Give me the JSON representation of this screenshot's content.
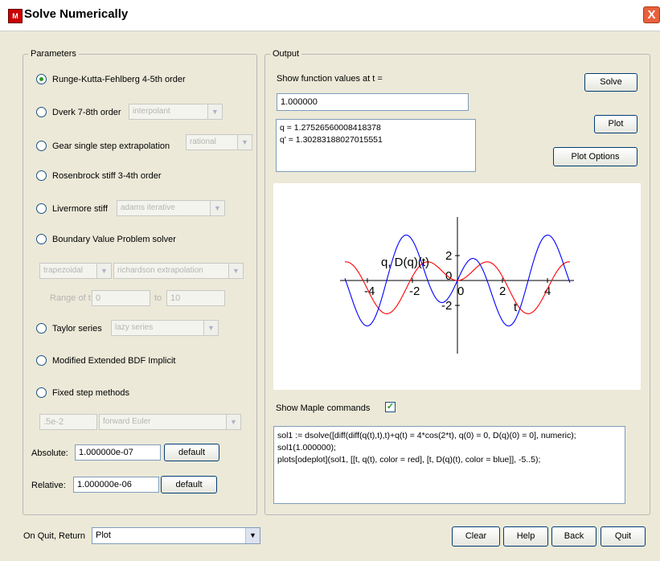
{
  "window": {
    "title": "Solve Numerically",
    "close_label": "X"
  },
  "parameters": {
    "legend": "Parameters",
    "methods": [
      {
        "label": "Runge-Kutta-Fehlberg 4-5th order",
        "selected": true
      },
      {
        "label": "Dverk 7-8th order",
        "option": "interpolant"
      },
      {
        "label": "Gear single step extrapolation",
        "option": "rational"
      },
      {
        "label": "Rosenbrock stiff 3-4th order"
      },
      {
        "label": "Livermore stiff",
        "option": "adams iterative"
      },
      {
        "label": "Boundary Value Problem solver"
      },
      {
        "label": "Taylor series",
        "option": "lazy series"
      },
      {
        "label": "Modified Extended BDF Implicit"
      },
      {
        "label": "Fixed step methods"
      }
    ],
    "bvp": {
      "method": "trapezoidal",
      "extrapolation": "richardson extrapolation",
      "range_label": "Range of t:",
      "range_from": "0",
      "to_label": "to",
      "range_to": "10"
    },
    "fixed_step": {
      "step": ".5e-2",
      "method": "forward Euler"
    },
    "absolute": {
      "label": "Absolute:",
      "value": "1.000000e-07",
      "default_label": "default"
    },
    "relative": {
      "label": "Relative:",
      "value": "1.000000e-06",
      "default_label": "default"
    }
  },
  "output": {
    "legend": "Output",
    "show_label": "Show function values at t =",
    "t_value": "1.000000",
    "results": "q = 1.27526560008418378\nq' = 1.30283188027015551",
    "solve_label": "Solve",
    "plot_label": "Plot",
    "plot_options_label": "Plot Options",
    "show_maple_label": "Show Maple commands",
    "show_maple_checked": true,
    "commands": "sol1 := dsolve([diff(diff(q(t),t),t)+q(t) = 4*cos(2*t), q(0) = 0, D(q)(0) = 0], numeric);\nsol1(1.000000);\nplots[odeplot](sol1, [[t, q(t), color = red], [t, D(q)(t), color = blue]], -5..5);"
  },
  "chart_data": {
    "type": "line",
    "xlabel": "t",
    "ylabel": "q, D(q)(t)",
    "xlim": [
      -5,
      5
    ],
    "ylim": [
      -3,
      3
    ],
    "xticks": [
      "-4",
      "-2",
      "0",
      "2",
      "4"
    ],
    "yticks": [
      "2",
      "0",
      "-2"
    ],
    "series": [
      {
        "color": "#ff0000",
        "formula": "q(t) = (4/3)(cos(t) - cos(2t))"
      },
      {
        "color": "#0000ff",
        "formula": "D(q)(t) = (4/3)(2 sin(2t) - sin(t))"
      }
    ]
  },
  "footer": {
    "on_quit_label": "On Quit, Return",
    "on_quit_value": "Plot",
    "clear_label": "Clear",
    "help_label": "Help",
    "back_label": "Back",
    "quit_label": "Quit"
  }
}
